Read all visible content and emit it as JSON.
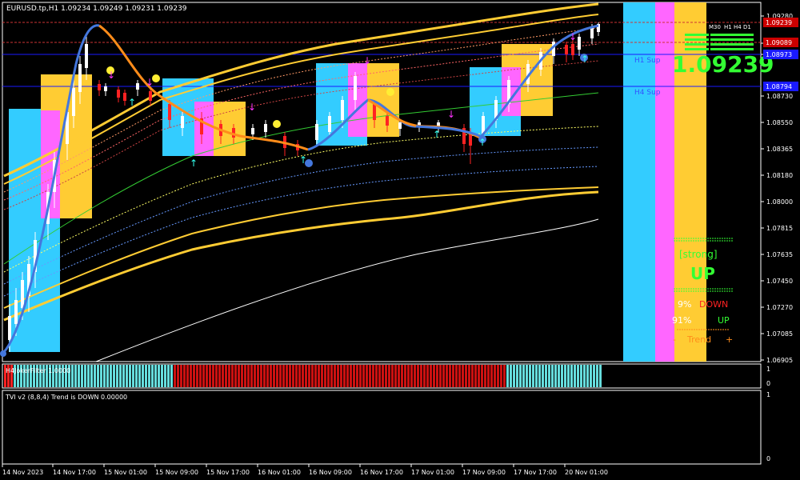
{
  "header": {
    "symbol_title": "EURUSD.tp,H1  1.09234 1.09249 1.09231 1.09239"
  },
  "price_axis": {
    "ticks": [
      "1.09280",
      "1.09089",
      "1.08973",
      "1.08730",
      "1.08550",
      "1.08365",
      "1.08180",
      "1.08000",
      "1.07815",
      "1.07635",
      "1.07450",
      "1.07270",
      "1.07085",
      "1.06905"
    ],
    "tags": [
      {
        "text": "1.09239",
        "color": "#cc0000"
      },
      {
        "text": "1.09089",
        "color": "#cc0000"
      },
      {
        "text": "1.08973",
        "color": "#1a1aff"
      },
      {
        "text": "1.08794",
        "color": "#1a1aff"
      }
    ]
  },
  "time_axis": {
    "labels": [
      "14 Nov 2023",
      "14 Nov 17:00",
      "15 Nov 01:00",
      "15 Nov 09:00",
      "15 Nov 17:00",
      "16 Nov 01:00",
      "16 Nov 09:00",
      "16 Nov 17:00",
      "17 Nov 01:00",
      "17 Nov 09:00",
      "17 Nov 17:00",
      "20 Nov 01:00"
    ]
  },
  "levels": {
    "h1_sup": "H1 Sup",
    "h4_sup": "H4 Sup"
  },
  "right_panel": {
    "tf_labels": [
      "M30",
      "H1",
      "H4",
      "D1"
    ],
    "big_price": "1.09239",
    "strength_label": "[strong]",
    "direction": "UP",
    "down_pct": "9%",
    "down_label": "DOWN",
    "up_pct": "91%",
    "up_label": "UP",
    "trend_left": "-",
    "trend_label": "Trend",
    "trend_right": "+"
  },
  "sub_panel_1": {
    "label": "H4JokerFilter 1.0000",
    "scale_top": "1",
    "scale_bottom": "0"
  },
  "sub_panel_2": {
    "label": "TVI v2 (8,8,4) Trend is DOWN 0.00000",
    "scale_top": "1",
    "scale_bottom": "0"
  },
  "colors": {
    "bull": "#ffffff",
    "bear": "#ff1a1a",
    "cyan_box": "#33ccff",
    "yellow_box": "#ffcc33",
    "pink_box": "#ff66ff",
    "orange_line": "#ff8c1a",
    "blue_line": "#4477dd",
    "green": "#33ff33"
  }
}
